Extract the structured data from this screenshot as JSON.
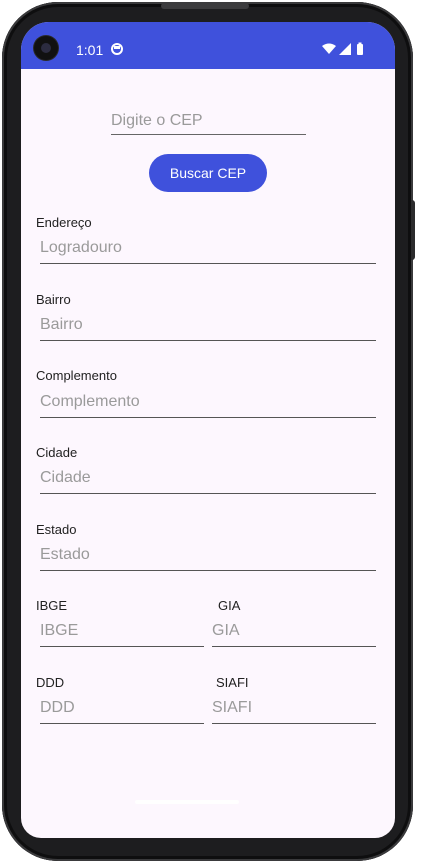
{
  "status_bar": {
    "time": "1:01",
    "color": "#3f51dc",
    "left_icon": "circle-dot-icon",
    "right_icons": [
      "wifi-icon",
      "signal-icon",
      "battery-icon"
    ]
  },
  "cep": {
    "placeholder": "Digite o CEP",
    "button_label": "Buscar CEP"
  },
  "fields": {
    "endereco": {
      "label": "Endereço",
      "placeholder": "Logradouro"
    },
    "bairro": {
      "label": "Bairro",
      "placeholder": "Bairro"
    },
    "complemento": {
      "label": "Complemento",
      "placeholder": "Complemento"
    },
    "cidade": {
      "label": "Cidade",
      "placeholder": "Cidade"
    },
    "estado": {
      "label": "Estado",
      "placeholder": "Estado"
    },
    "ibge": {
      "label": "IBGE",
      "placeholder": "IBGE"
    },
    "gia": {
      "label": "GIA",
      "placeholder": "GIA"
    },
    "ddd": {
      "label": "DDD",
      "placeholder": "DDD"
    },
    "siafi": {
      "label": "SIAFI",
      "placeholder": "SIAFI"
    }
  },
  "colors": {
    "accent": "#3f51dc",
    "background": "#fdf7fe",
    "hint_text": "#9a9a9a"
  }
}
